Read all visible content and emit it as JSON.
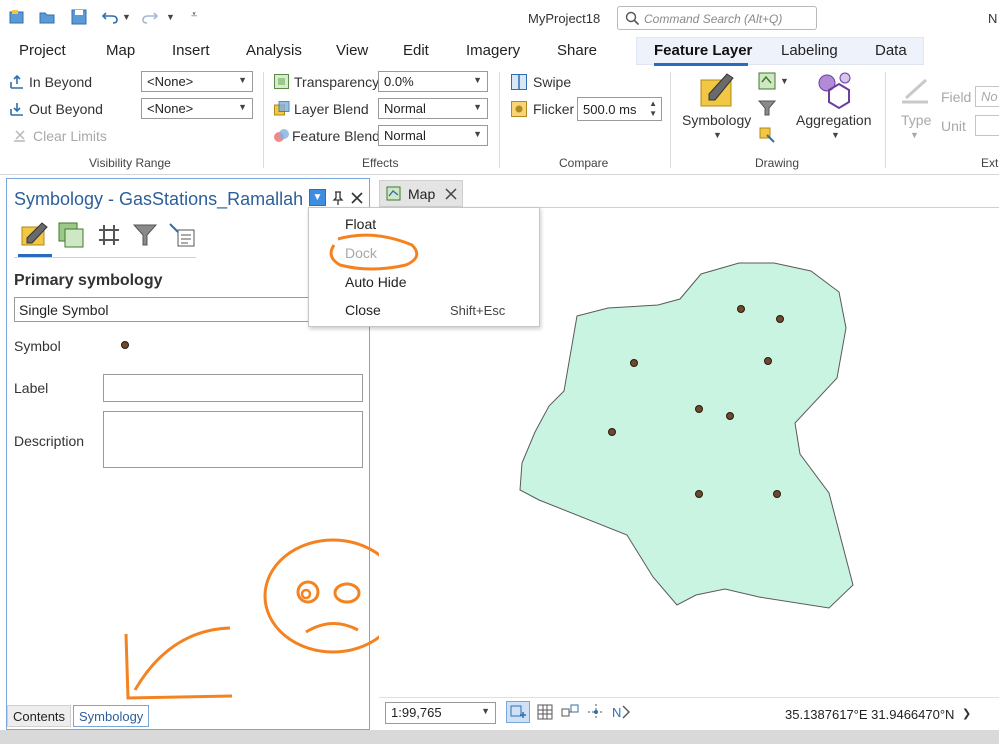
{
  "app": {
    "title": "MyProject18",
    "search_placeholder": "Command Search (Alt+Q)",
    "user_initial": "N"
  },
  "tabs": [
    "Project",
    "Map",
    "Insert",
    "Analysis",
    "View",
    "Edit",
    "Imagery",
    "Share",
    "Feature Layer",
    "Labeling",
    "Data"
  ],
  "active_tab": "Feature Layer",
  "ribbon": {
    "visibility": {
      "in_beyond": "In Beyond",
      "out_beyond": "Out Beyond",
      "clear_limits": "Clear Limits",
      "in_value": "<None>",
      "out_value": "<None>",
      "group": "Visibility Range"
    },
    "effects": {
      "transparency": "Transparency",
      "transparency_value": "0.0%",
      "layer_blend": "Layer Blend",
      "layer_blend_value": "Normal",
      "feature_blend": "Feature Blend",
      "feature_blend_value": "Normal",
      "group": "Effects"
    },
    "compare": {
      "swipe": "Swipe",
      "flicker": "Flicker",
      "flicker_value": "500.0  ms",
      "group": "Compare"
    },
    "drawing": {
      "symbology": "Symbology",
      "aggregation": "Aggregation",
      "group": "Drawing"
    },
    "extrusion": {
      "type": "Type",
      "field": "Field",
      "unit": "Unit",
      "field_value": "No",
      "group": "Extr"
    }
  },
  "pane": {
    "title": "Symbology - GasStations_Ramallah",
    "primary": "Primary symbology",
    "renderer": "Single Symbol",
    "symbol_label": "Symbol",
    "label_label": "Label",
    "description_label": "Description",
    "bottom_tabs": [
      "Contents",
      "Symbology"
    ],
    "active_bottom_tab": "Symbology"
  },
  "map_tab": {
    "label": "Map"
  },
  "menu": {
    "items": [
      {
        "label": "Float",
        "shortcut": "",
        "enabled": true
      },
      {
        "label": "Dock",
        "shortcut": "",
        "enabled": false
      },
      {
        "label": "Auto Hide",
        "shortcut": "",
        "enabled": true
      },
      {
        "label": "Close",
        "shortcut": "Shift+Esc",
        "enabled": true
      }
    ]
  },
  "status": {
    "scale": "1:99,765",
    "coords": "35.1387617°E 31.9466470°N"
  },
  "colors": {
    "accent": "#2b6bbf",
    "polygon_fill": "#c9f4e2",
    "annotation": "#f58220"
  }
}
